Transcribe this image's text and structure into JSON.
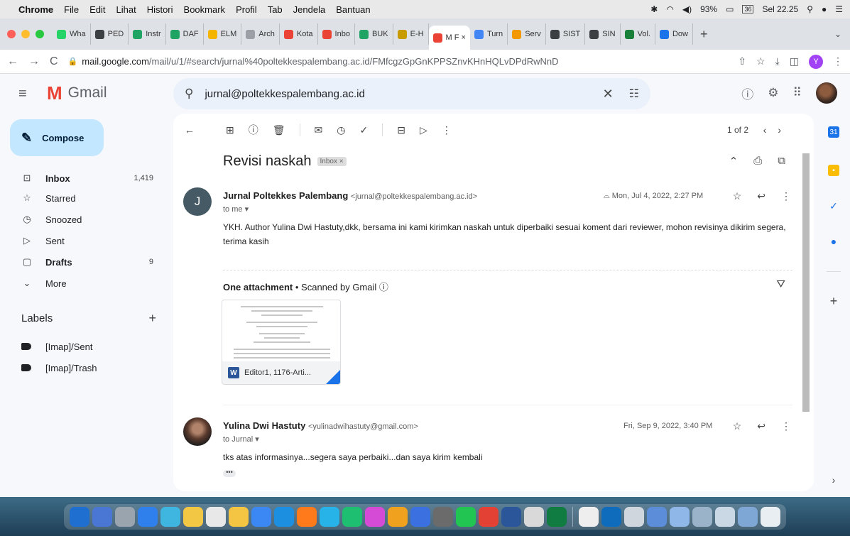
{
  "menubar": {
    "app": "Chrome",
    "items": [
      "File",
      "Edit",
      "Lihat",
      "Histori",
      "Bookmark",
      "Profil",
      "Tab",
      "Jendela",
      "Bantuan"
    ],
    "battery": "93%",
    "date_badge": "36",
    "clock": "Sel 22.25"
  },
  "tabs": [
    {
      "label": "Wha",
      "color": "#25d366"
    },
    {
      "label": "PED",
      "color": "#3c4043"
    },
    {
      "label": "Instr",
      "color": "#1fa463"
    },
    {
      "label": "DAF",
      "color": "#1fa463"
    },
    {
      "label": "ELM",
      "color": "#f4b400"
    },
    {
      "label": "Arch",
      "color": "#9aa0a6"
    },
    {
      "label": "Kota",
      "color": "#ea4335"
    },
    {
      "label": "Inbo",
      "color": "#ea4335"
    },
    {
      "label": "BUK",
      "color": "#1fa463"
    },
    {
      "label": "E-H",
      "color": "#c89b00"
    },
    {
      "label": "M F ×",
      "color": "#ea4335",
      "active": true
    },
    {
      "label": "Turn",
      "color": "#4285f4"
    },
    {
      "label": "Serv",
      "color": "#f29900"
    },
    {
      "label": "SIST",
      "color": "#3c4043"
    },
    {
      "label": "SIN",
      "color": "#3c4043"
    },
    {
      "label": "Vol.",
      "color": "#188038"
    },
    {
      "label": "Dow",
      "color": "#1a73e8"
    }
  ],
  "address": {
    "host": "mail.google.com",
    "path": "/mail/u/1/#search/jurnal%40poltekkespalembang.ac.id/FMfcgzGpGnKPPSZnvKHnHQLvDPdRwNnD",
    "profile_initial": "Y"
  },
  "gmail": {
    "brand": "Gmail",
    "search_query": "jurnal@poltekkespalembang.ac.id",
    "compose_label": "Compose"
  },
  "nav": [
    {
      "label": "Inbox",
      "count": "1,419",
      "icon": "inbox-icon",
      "bold": true
    },
    {
      "label": "Starred",
      "count": "",
      "icon": "star-icon"
    },
    {
      "label": "Snoozed",
      "count": "",
      "icon": "clock-icon"
    },
    {
      "label": "Sent",
      "count": "",
      "icon": "send-icon"
    },
    {
      "label": "Drafts",
      "count": "9",
      "icon": "draft-icon",
      "bold": true
    },
    {
      "label": "More",
      "count": "",
      "icon": "chevron-down-icon"
    }
  ],
  "labels": {
    "heading": "Labels",
    "items": [
      "[Imap]/Sent",
      "[Imap]/Trash"
    ]
  },
  "toolbar": {
    "pagination": "1 of 2"
  },
  "thread": {
    "subject": "Revisi naskah",
    "chip": "Inbox ×",
    "messages": [
      {
        "avatar_initial": "J",
        "sender_name": "Jurnal Poltekkes Palembang",
        "sender_email": "<jurnal@poltekkespalembang.ac.id>",
        "to": "to me",
        "date": "Mon, Jul 4, 2022, 2:27 PM",
        "body_line1": "YKH. Author Yulina Dwi Hastuty,dkk, bersama ini kami kirimkan naskah untuk diperbaiki sesuai koment dari reviewer, mohon revisinya dikirim segera,",
        "body_line2": "terima kasih"
      },
      {
        "sender_name": "Yulina Dwi Hastuty",
        "sender_email": "<yulinadwihastuty@gmail.com>",
        "to": "to Jurnal",
        "date": "Fri, Sep 9, 2022, 3:40 PM",
        "body_line1": "tks atas informasinya...segera saya perbaiki...dan saya kirim kembali"
      }
    ],
    "attachment": {
      "heading": "One attachment",
      "scan_note": "Scanned by Gmail",
      "filename": "Editor1, 1176-Arti..."
    },
    "collapsed_marker": "•••"
  },
  "colors": {
    "accent": "#1a73e8",
    "compose_bg": "#c2e7ff",
    "search_bg": "#eaf1fb",
    "gmail_red": "#ea4335"
  }
}
